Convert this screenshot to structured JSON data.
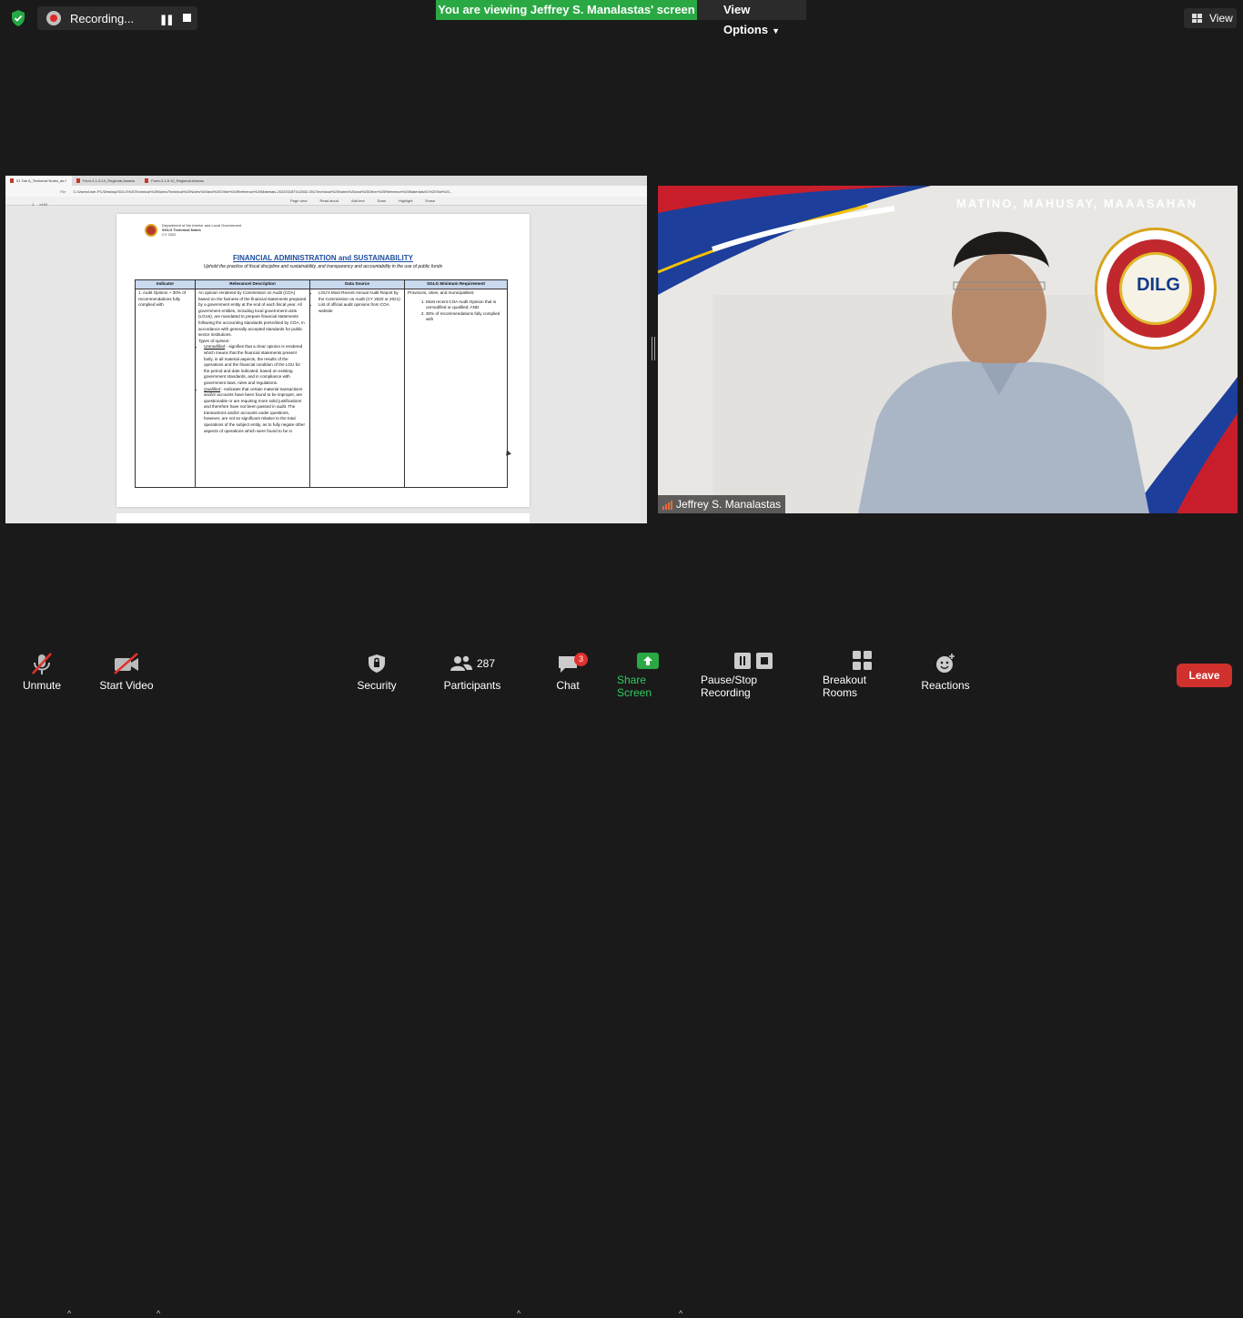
{
  "top": {
    "recording_label": "Recording...",
    "viewing_banner": "You are viewing Jeffrey S. Manalastas' screen",
    "view_options": "View Options",
    "view_button": "View"
  },
  "shared_screen": {
    "tabs": [
      "01 Tab A_Technical Notes_as f",
      "Form-3.1-5.10_Regional-Assess",
      "Form-3.1-5.10_Regional-Assess"
    ],
    "address": "C:/Users/User-PC/Desktop/SGLG%20Technical%20Notes/Technical%20Notes%20and%20Other%20Reference%20Materials-20220318T012832-001/Technical%20Notes%20and%20Other%20Reference%20Materials/01%20Tab%20...",
    "file_label": "File",
    "page_number": "1",
    "page_total": "of 61",
    "toolbar": [
      "Page view",
      "Read aloud",
      "Add text",
      "Draw",
      "Highlight",
      "Erase"
    ],
    "doc": {
      "agency": "Department of the Interior and Local Government",
      "notes": "SGLG Technical Notes",
      "year": "CY 2022",
      "title": "FINANCIAL ADMINISTRATION and SUSTAINABILITY",
      "subtitle": "Uphold the practice of fiscal discipline and sustainability, and transparency and accountability in the use of public funds",
      "headers": [
        "Indicator",
        "Relevance/ Description",
        "Data Source",
        "SGLG Minimum Requirement"
      ],
      "indicator": "1. Audit Opinion + 30% of recommendations fully complied with",
      "description": "An opinion rendered by Commission on Audit (COA) based on the fairness of the financial statements prepared by a government entity at the end of each fiscal year. All government entities, including local government units (LGUs), are mandated to prepare financial statements following the accounting standards prescribed by COA, in accordance with generally accepted standards for public sector institutions.",
      "types_label": "Types of opinion:",
      "type_1_name": "Unmodified",
      "type_1_text": " - signifies that a clear opinion is rendered which means that the financial statements present fairly, in all material aspects, the results of the operations and the financial condition of the LGU for the period and date indicated, based on existing government standards, and in compliance with government laws, rules and regulations.",
      "type_2_name": "Qualified",
      "type_2_text": " - Indicates that certain material transactions and/or accounts have been found to be improper, are questionable or are requiring more solid justifications and therefore have not been passed in audit. The transactions and/or accounts under questions, however, are not so significant relative to the total operations of the subject entity, as to fully negate other aspects of operations which were found to be in",
      "sources": [
        "LGU's Most Recent Annual Audit Report by the Commission on Audit (CY 2020 or 2021)",
        "List of official audit opinions from COA website"
      ],
      "req_intro": "Provinces, cities, and municipalities:",
      "requirements": [
        "Most recent COA Audit Opinion that is unmodified or qualified; AND",
        "30% of recommendations fully complied with"
      ]
    }
  },
  "video": {
    "motto": "MATINO, MAHUSAY, MAAASAHAN",
    "seal_text": "DILG",
    "participant_name": "Jeffrey S. Manalastas"
  },
  "toolbar": {
    "unmute": "Unmute",
    "start_video": "Start Video",
    "security": "Security",
    "participants": "Participants",
    "participant_count": "287",
    "chat": "Chat",
    "chat_badge": "3",
    "share_screen": "Share Screen",
    "recording": "Pause/Stop Recording",
    "breakout": "Breakout Rooms",
    "reactions": "Reactions",
    "leave": "Leave"
  },
  "colors": {
    "zoom_green": "#2aa844",
    "leave_red": "#d0312d",
    "background": "#1a1a1a"
  }
}
